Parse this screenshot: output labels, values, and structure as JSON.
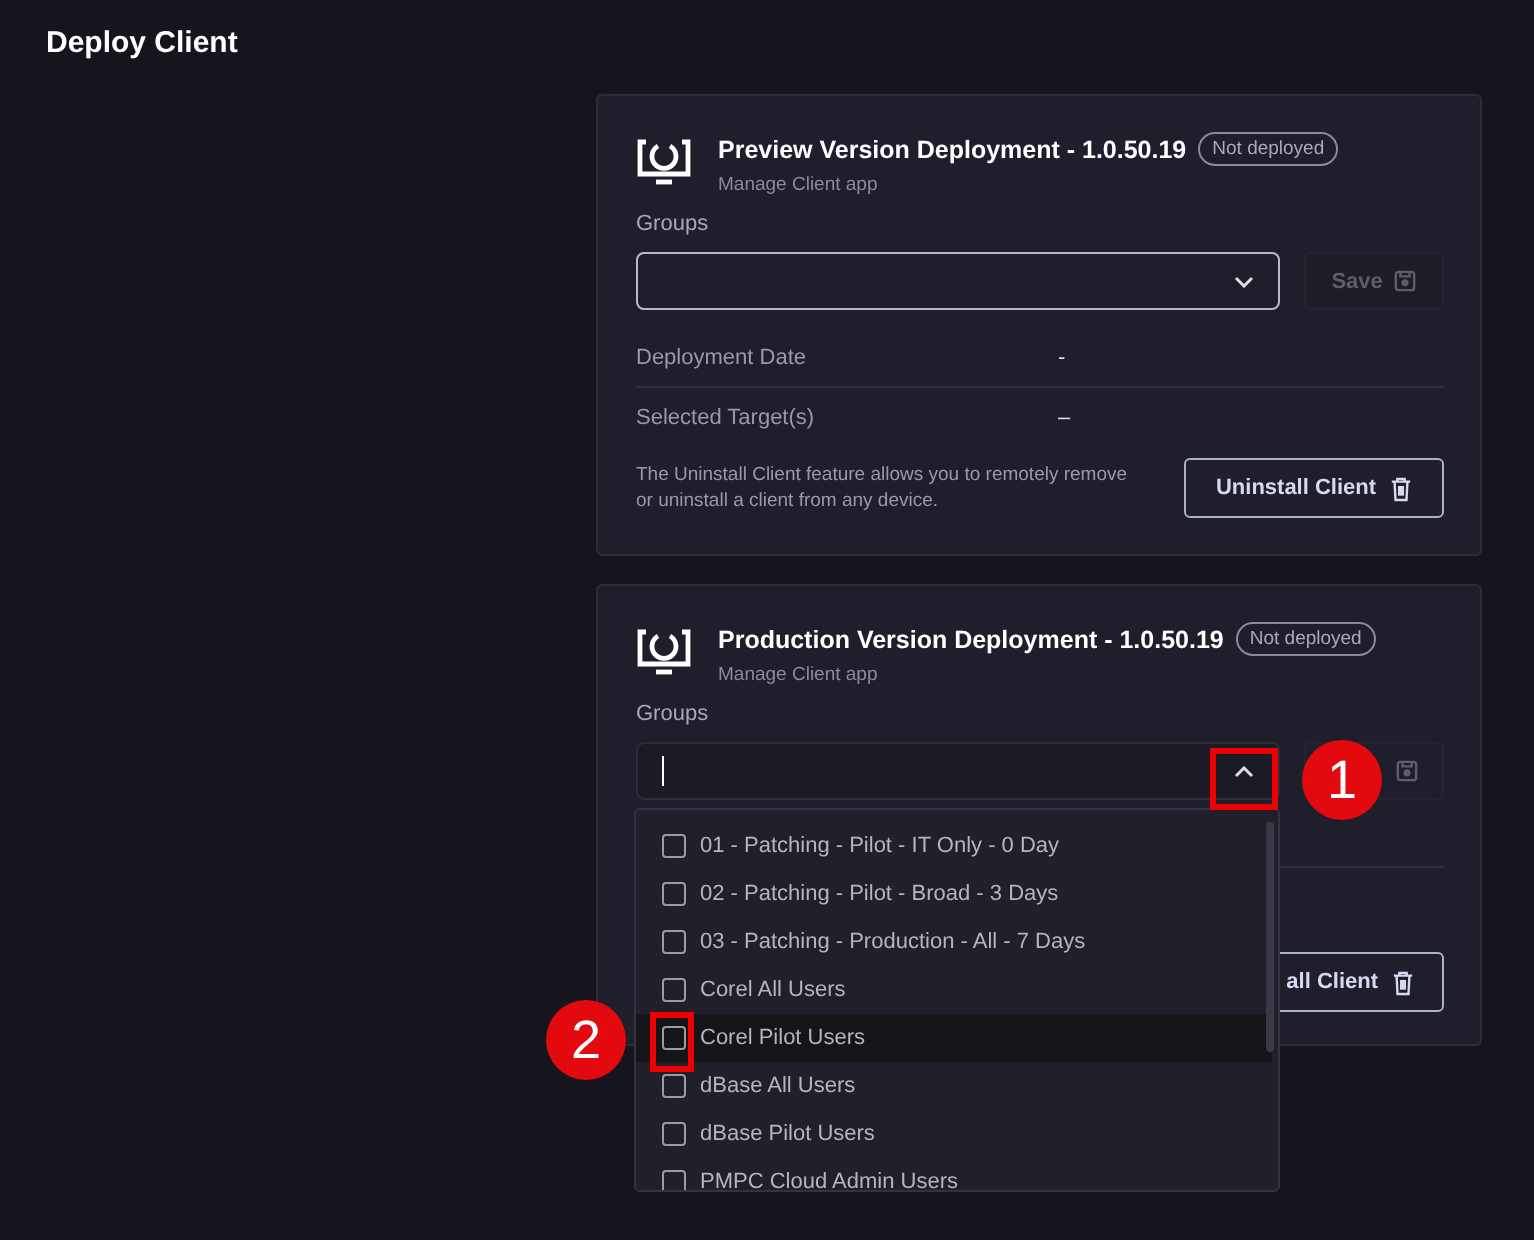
{
  "page": {
    "title": "Deploy Client"
  },
  "cards": [
    {
      "title": "Preview Version Deployment - 1.0.50.19",
      "status": "Not deployed",
      "subtitle": "Manage Client app",
      "groups_label": "Groups",
      "groups_field": {
        "open": false
      },
      "save": {
        "label": "Save",
        "disabled": true
      },
      "details": [
        {
          "label": "Deployment Date",
          "value": "-"
        },
        {
          "label": "Selected Target(s)",
          "value": "–"
        }
      ],
      "note": "The Uninstall Client feature allows you to remotely remove or uninstall a client from any device.",
      "uninstall_label": "Uninstall Client"
    },
    {
      "title": "Production Version Deployment - 1.0.50.19",
      "status": "Not deployed",
      "subtitle": "Manage Client app",
      "groups_label": "Groups",
      "groups_field": {
        "open": true
      },
      "save": {
        "disabled": true
      },
      "uninstall_label": "all Client"
    }
  ],
  "dropdown": {
    "options": [
      {
        "label": "01 - Patching - Pilot - IT Only - 0 Day",
        "checked": false,
        "highlighted": false
      },
      {
        "label": "02 - Patching - Pilot - Broad - 3 Days",
        "checked": false,
        "highlighted": false
      },
      {
        "label": "03 - Patching - Production - All - 7 Days",
        "checked": false,
        "highlighted": false
      },
      {
        "label": "Corel All Users",
        "checked": false,
        "highlighted": false
      },
      {
        "label": "Corel Pilot Users",
        "checked": false,
        "highlighted": true
      },
      {
        "label": "dBase All Users",
        "checked": false,
        "highlighted": false
      },
      {
        "label": "dBase Pilot Users",
        "checked": false,
        "highlighted": false
      },
      {
        "label": "PMPC Cloud Admin Users",
        "checked": false,
        "highlighted": false
      }
    ]
  },
  "annotations": [
    {
      "number": "1"
    },
    {
      "number": "2"
    }
  ]
}
